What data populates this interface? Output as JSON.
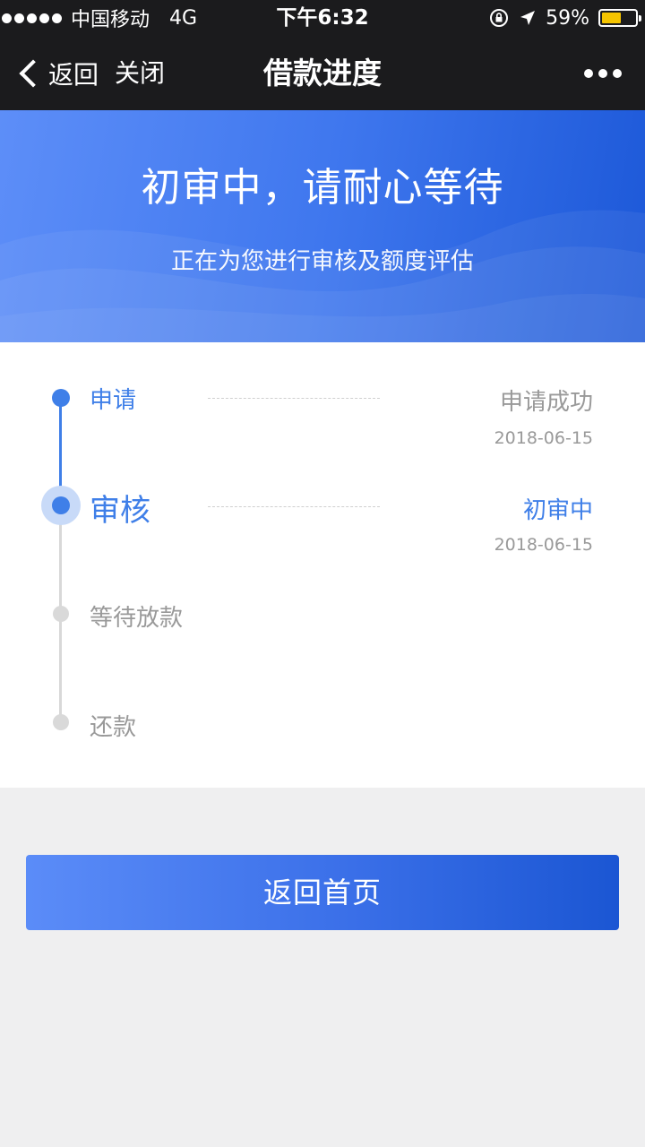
{
  "status_bar": {
    "carrier": "中国移动",
    "network": "4G",
    "time": "下午6:32",
    "battery_percent": "59%",
    "battery_level": 0.59
  },
  "nav": {
    "back_label": "返回",
    "close_label": "关闭",
    "title": "借款进度"
  },
  "banner": {
    "title": "初审中，请耐心等待",
    "subtitle": "正在为您进行审核及额度评估"
  },
  "timeline": {
    "steps": [
      {
        "label": "申请",
        "status": "申请成功",
        "date": "2018-06-15"
      },
      {
        "label": "审核",
        "status": "初审中",
        "date": "2018-06-15"
      },
      {
        "label": "等待放款"
      },
      {
        "label": "还款"
      }
    ],
    "current_step": 2
  },
  "home_button": {
    "label": "返回首页"
  },
  "colors": {
    "accent": "#3f7fe8",
    "nav_bg": "#1b1b1d",
    "pending": "#d9d9d9",
    "battery": "#f5c400"
  }
}
